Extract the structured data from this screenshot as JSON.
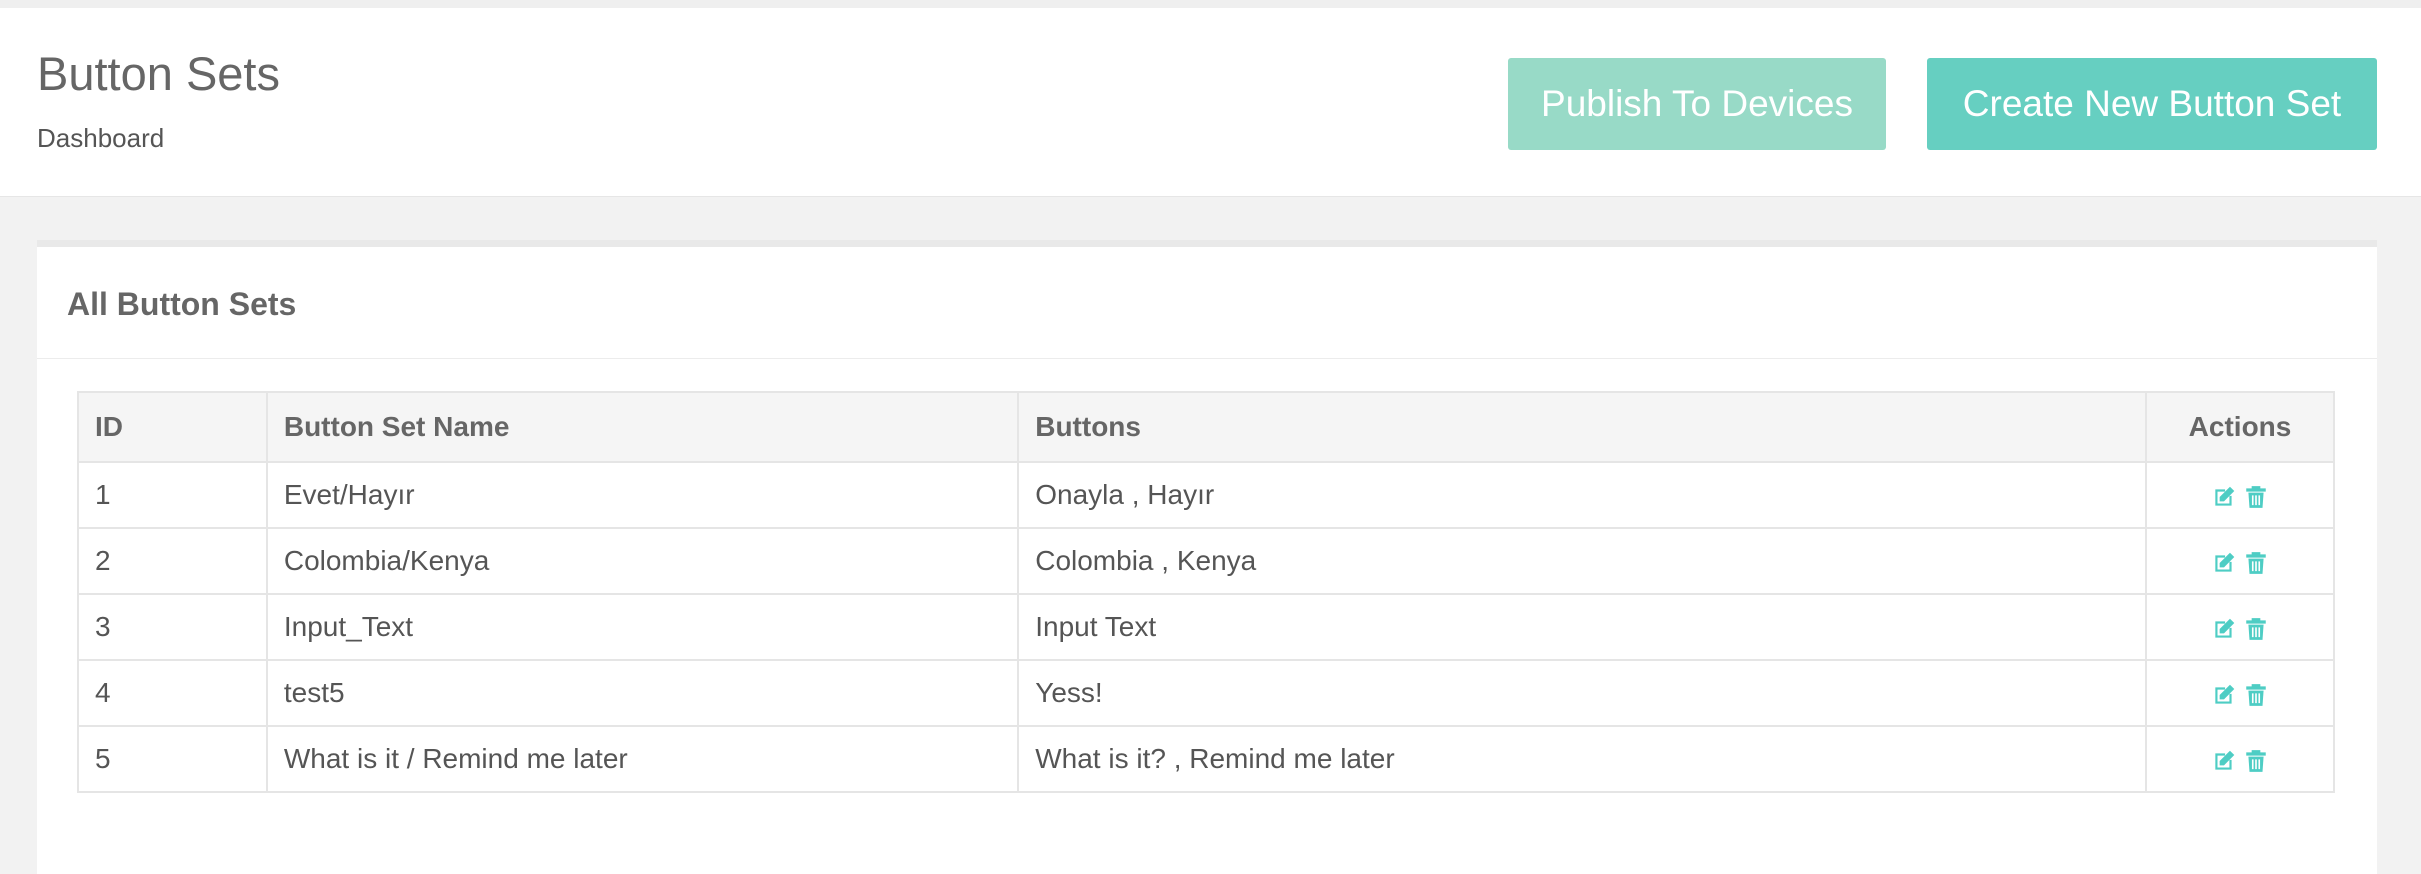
{
  "header": {
    "title": "Button Sets",
    "breadcrumb": "Dashboard",
    "publish_label": "Publish To Devices",
    "create_label": "Create New Button Set"
  },
  "panel": {
    "title": "All Button Sets"
  },
  "table": {
    "columns": [
      "ID",
      "Button Set Name",
      "Buttons",
      "Actions"
    ],
    "rows": [
      {
        "id": "1",
        "name": "Evet/Hayır",
        "buttons": "Onayla , Hayır"
      },
      {
        "id": "2",
        "name": "Colombia/Kenya",
        "buttons": "Colombia , Kenya"
      },
      {
        "id": "3",
        "name": "Input_Text",
        "buttons": "Input Text"
      },
      {
        "id": "4",
        "name": "test5",
        "buttons": "Yess!"
      },
      {
        "id": "5",
        "name": "What is it / Remind me later",
        "buttons": "What is it? , Remind me later"
      }
    ],
    "action_icons": [
      "edit-icon",
      "trash-icon"
    ]
  },
  "colors": {
    "publish_button": "#98dac7",
    "create_button": "#66cfc1",
    "action_icon": "#4ecdc4"
  }
}
